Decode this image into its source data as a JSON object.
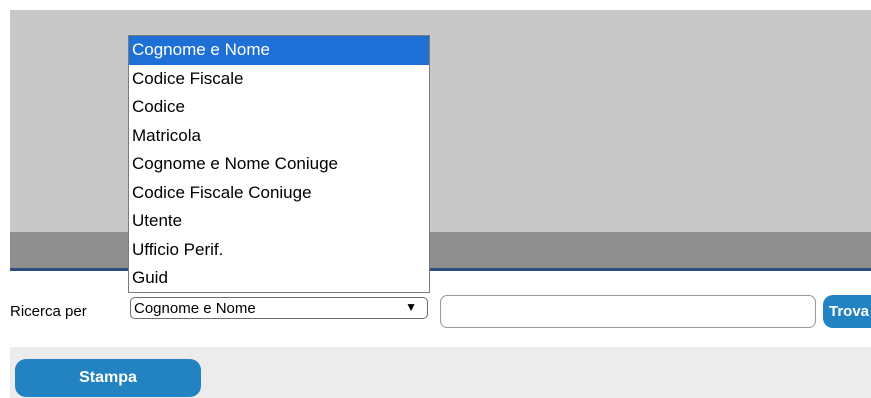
{
  "search": {
    "label": "Ricerca per",
    "selected": "Cognome e Nome",
    "input_value": "",
    "find_label": "Trova"
  },
  "dropdown": {
    "options": [
      "Cognome e Nome",
      "Codice Fiscale",
      "Codice",
      "Matricola",
      "Cognome e Nome Coniuge",
      "Codice Fiscale Coniuge",
      "Utente",
      "Ufficio Perif.",
      "Guid"
    ],
    "selected_index": 0
  },
  "footer": {
    "print_label": "Stampa"
  },
  "colors": {
    "accent": "#2282c2",
    "highlight": "#1e6fd6",
    "panel": "#c8c8c8"
  }
}
